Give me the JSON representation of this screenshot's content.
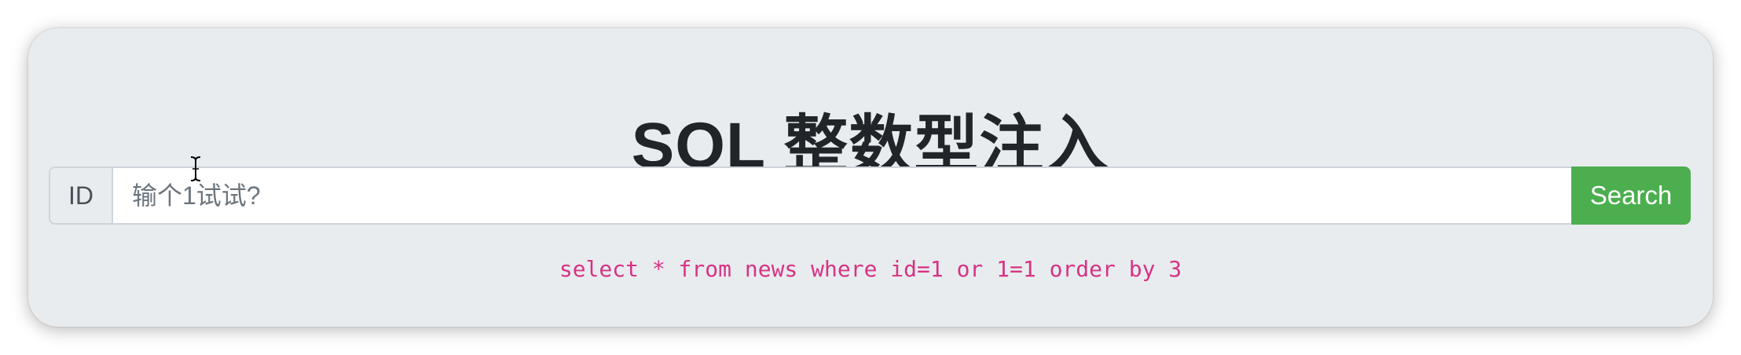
{
  "page": {
    "title": "SQL 整数型注入"
  },
  "search": {
    "addon_label": "ID",
    "placeholder": "输个1试试?",
    "value": "",
    "button_label": "Search"
  },
  "query": {
    "sql": "select * from news where id=1 or 1=1 order by 3"
  },
  "colors": {
    "card_background": "#e9ecef",
    "button_green": "#4cae4f",
    "sql_text": "#d63384",
    "title_text": "#212529"
  },
  "icons": {
    "mouse_cursor": "text-cursor-icon"
  }
}
